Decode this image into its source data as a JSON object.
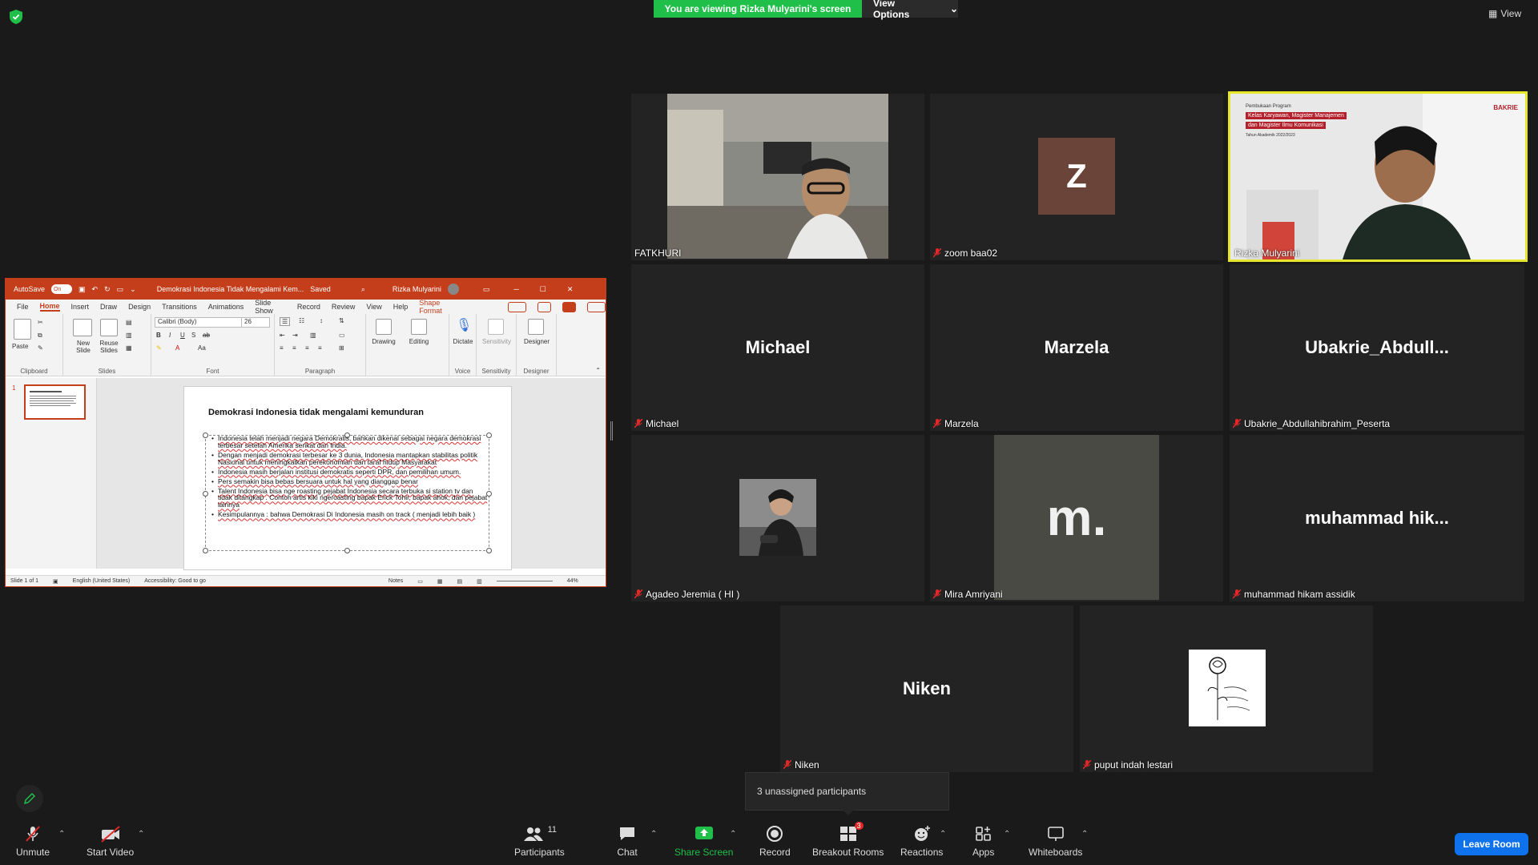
{
  "banner": {
    "viewing_text": "You are viewing Rizka Mulyarini's screen",
    "view_options": "View Options",
    "view": "View"
  },
  "ppt": {
    "autosave": "AutoSave",
    "toggle": "On",
    "doc_title": "Demokrasi Indonesia Tidak Mengalami Kem...",
    "saved": "Saved",
    "user": "Rizka Mulyarini",
    "tabs": [
      "File",
      "Home",
      "Insert",
      "Draw",
      "Design",
      "Transitions",
      "Animations",
      "Slide Show",
      "Record",
      "Review",
      "View",
      "Help",
      "Shape Format"
    ],
    "ribbon": {
      "paste": "Paste",
      "clipboard": "Clipboard",
      "new_slide": "New Slide",
      "reuse_slides": "Reuse Slides",
      "slides": "Slides",
      "font_name": "Calibri (Body)",
      "font_size": "26",
      "font": "Font",
      "paragraph": "Paragraph",
      "drawing": "Drawing",
      "editing": "Editing",
      "dictate": "Dictate",
      "voice": "Voice",
      "sensitivity": "Sensitivity",
      "sensitivity_group": "Sensitivity",
      "designer": "Designer",
      "designer_group": "Designer"
    },
    "thumb_number": "1",
    "slide_title": "Demokrasi Indonesia tidak mengalami kemunduran",
    "bullets": [
      "Indonesia telah menjadi negara Demokratis, bahkan dikenal sebagai negara demokrasi terbesar setelah Amerika serikat dan India.",
      "Dengan menjadi demokrasi terbesar ke 3 dunia, Indonesia mantapkan stabilitas politik Nasional untuk meningkatkan perekonomian dan taraf hidup Masyarakat",
      "Indonesia masih berjalan institusi demokratis seperti DPR, dan pemilihan umum.",
      "Pers semakin bisa bebas bersuara untuk hal yang dianggap benar",
      "Talent Indonesia bisa nge roasting pejabat Indonesia secara terbuka si station tv dan tidak ditangkap . Contoh artis kiki ngeroasting bapak Erick Tohir, bapak ahok, dan pejabat lainnya",
      "Kesimpulannya : bahwa Demokrasi Di Indonesia masih on track ( menjadi lebih baik )"
    ],
    "status": {
      "slide": "Slide 1 of 1",
      "language": "English (United States)",
      "accessibility": "Accessibility: Good to go",
      "notes": "Notes",
      "zoom": "44%"
    }
  },
  "participants": [
    {
      "name": "FATKHURI",
      "display": "",
      "muted": false,
      "video": "photo-man"
    },
    {
      "name": "zoom baa02",
      "display": "Z",
      "muted": true,
      "video": "avatar"
    },
    {
      "name": "Rizka Mulyarini",
      "display": "",
      "muted": false,
      "video": "photo-woman"
    },
    {
      "name": "Michael",
      "display": "Michael",
      "muted": true,
      "video": "none"
    },
    {
      "name": "Marzela",
      "display": "Marzela",
      "muted": true,
      "video": "none"
    },
    {
      "name": "Ubakrie_Abdullahibrahim_Peserta",
      "display": "Ubakrie_Abdull...",
      "muted": true,
      "video": "none"
    },
    {
      "name": "Agadeo Jeremia ( HI )",
      "display": "",
      "muted": true,
      "video": "profile-photo"
    },
    {
      "name": "Mira Amriyani",
      "display": "",
      "muted": true,
      "video": "logo"
    },
    {
      "name": "muhammad hikam assidik",
      "display": "muhammad  hik...",
      "muted": true,
      "video": "none"
    },
    {
      "name": "Niken",
      "display": "Niken",
      "muted": true,
      "video": "none"
    },
    {
      "name": "puput indah lestari",
      "display": "",
      "muted": true,
      "video": "sketch"
    }
  ],
  "rizka_overlay": {
    "line1": "Pembukaan Program",
    "line2": "Kelas Karyawan, Magister Manajemen",
    "line3": "dan Magister Ilmu Komunikasi",
    "line4": "Tahun Akademik 2022/2023",
    "logo": "BAKRIE"
  },
  "mira_logo": "m.",
  "unassigned": "3 unassigned participants",
  "toolbar": {
    "unmute": "Unmute",
    "start_video": "Start Video",
    "participants": "Participants",
    "participants_count": "11",
    "chat": "Chat",
    "share_screen": "Share Screen",
    "record": "Record",
    "breakout_rooms": "Breakout Rooms",
    "breakout_count": "3",
    "reactions": "Reactions",
    "apps": "Apps",
    "whiteboards": "Whiteboards",
    "leave": "Leave Room"
  },
  "colors": {
    "banner_green": "#1fbf4a",
    "ppt_accent": "#c43e1c",
    "active_speaker": "#e6e62a",
    "leave_blue": "#0e72ed",
    "muted_red": "#e02828"
  }
}
